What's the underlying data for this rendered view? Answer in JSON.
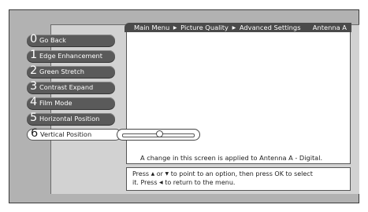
{
  "breadcrumb": {
    "items": [
      "Main Menu",
      "Picture Quality",
      "Advanced Settings"
    ],
    "separator_icon": "triangle-right-icon",
    "antenna": "Antenna A"
  },
  "menu": {
    "items": [
      {
        "number": "0",
        "label": "Go Back"
      },
      {
        "number": "1",
        "label": "Edge Enhancement"
      },
      {
        "number": "2",
        "label": "Green Stretch"
      },
      {
        "number": "3",
        "label": "Contrast Expand"
      },
      {
        "number": "4",
        "label": "Film Mode"
      },
      {
        "number": "5",
        "label": "Horizontal Position"
      },
      {
        "number": "6",
        "label": "Vertical Position"
      }
    ],
    "selected_index": 6
  },
  "slider": {
    "level": 0.5
  },
  "notice": "A change in this screen is applied to Antenna A - Digital.",
  "help": {
    "press": "Press",
    "or": "or",
    "line1_rest": "to point to an option, then press OK to select",
    "line2_start": "it. Press",
    "line2_rest": "to return to the menu."
  },
  "colors": {
    "menu_item_bg": "#5a5a5a",
    "breadcrumb_bg": "#4a4a4a",
    "screen_bg": "#b2b2b2",
    "panel_bg": "#d2d2d2"
  }
}
